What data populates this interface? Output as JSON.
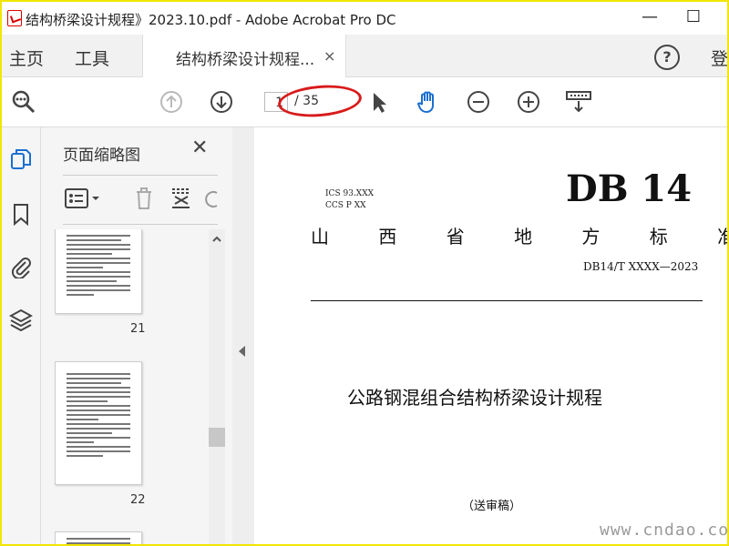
{
  "window": {
    "title": "结构桥梁设计规程》2023.10.pdf - Adobe Acrobat Pro DC",
    "minimize": "—",
    "maximize": "☐"
  },
  "nav": {
    "home": "主页",
    "tools": "工具",
    "doc_tab": "结构桥梁设计规程...",
    "doc_tab_close": "×",
    "help": "?",
    "signin": "登"
  },
  "toolbar": {
    "page_current": "1",
    "page_total": "/ 35"
  },
  "thumbnails": {
    "title": "页面缩略图",
    "close": "✕",
    "pages": [
      "21",
      "22"
    ]
  },
  "document": {
    "ics": "ICS 93.XXX",
    "ccs": "CCS P XX",
    "db_code": "DB 14",
    "region_title": "山 西 省 地 方 标 准",
    "standard_number": "DB14/T XXXX—2023",
    "doc_title": "公路钢混组合结构桥梁设计规程",
    "status": "（送审稿）"
  },
  "watermark": "www.cndao.com",
  "colors": {
    "accent_blue": "#1a6fd1",
    "annotation_red": "#d81b1b",
    "frame_yellow": "#f2e500"
  }
}
